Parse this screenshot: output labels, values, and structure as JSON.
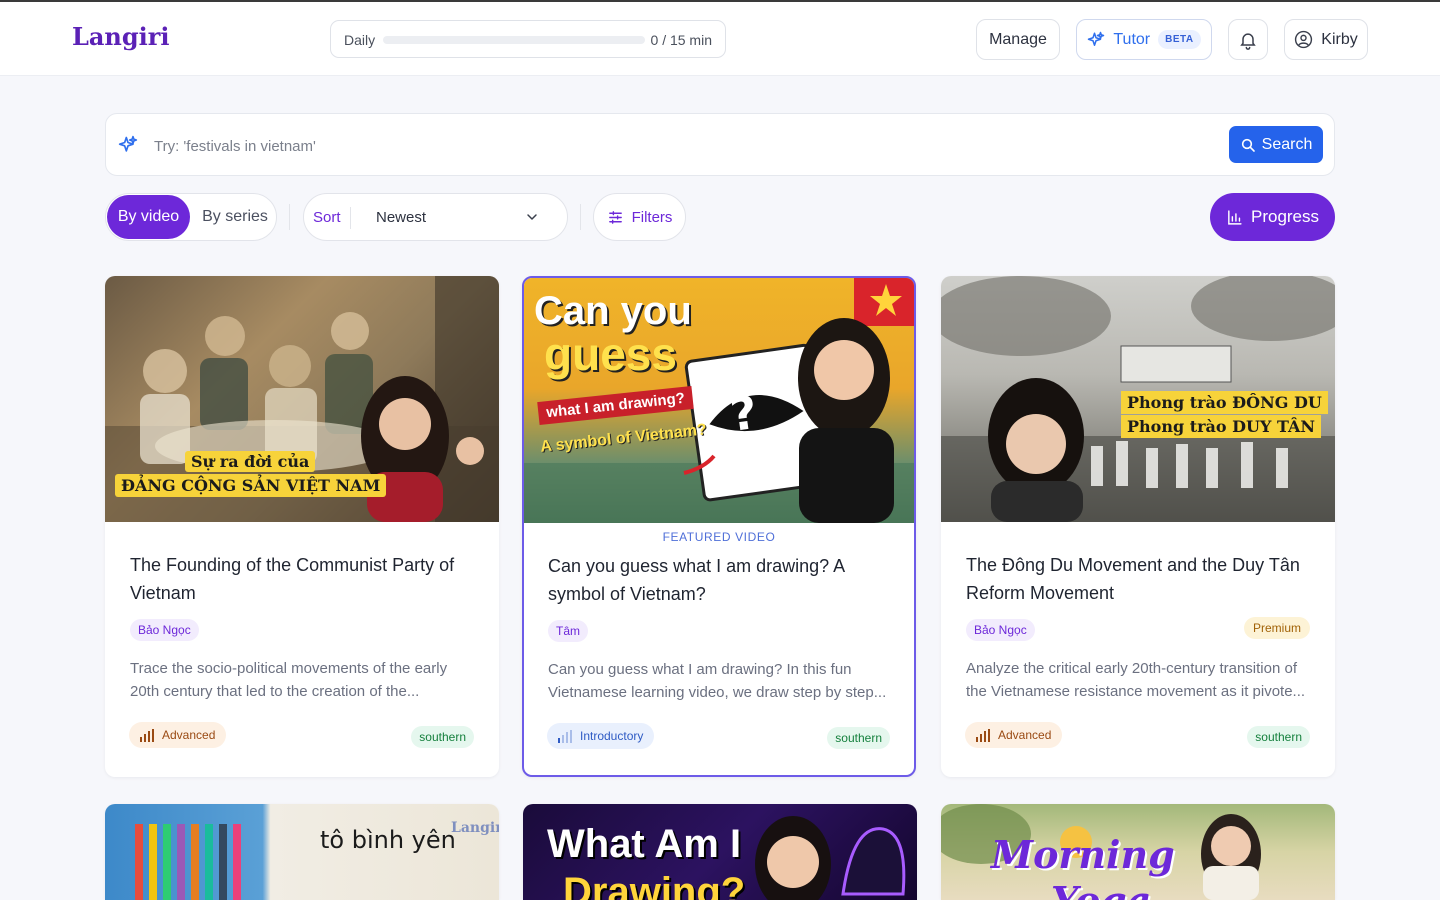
{
  "app": {
    "name": "Langiri"
  },
  "header": {
    "daily": {
      "label": "Daily",
      "progress_fraction": 0,
      "value_text": "0 / 15 min"
    },
    "manage_label": "Manage",
    "tutor_label": "Tutor",
    "tutor_badge": "BETA",
    "user_name": "Kirby"
  },
  "search": {
    "placeholder": "Try: 'festivals in vietnam'",
    "button_label": "Search"
  },
  "view_toggle": {
    "active": "By video",
    "other": "By series"
  },
  "sort": {
    "label": "Sort",
    "value": "Newest"
  },
  "filters_label": "Filters",
  "progress_label": "Progress",
  "colors": {
    "brand": "#6d28d9",
    "accent_blue": "#2563eb"
  },
  "cards": [
    {
      "thumb_text": [
        "Sự ra đời của",
        "ĐẢNG CỘNG SẢN VIỆT NAM"
      ],
      "title": "The Founding of the Communist Party of Vietnam",
      "author": "Bảo Ngọc",
      "description": "Trace the socio-political movements of the early 20th century that led to the creation of the...",
      "level": "Advanced",
      "region": "southern"
    },
    {
      "featured_label": "FEATURED VIDEO",
      "thumb_text": [
        "Can you",
        "guess",
        "what I am drawing?",
        "A symbol of Vietnam?"
      ],
      "title": "Can you guess what I am drawing? A symbol of Vietnam?",
      "author": "Tâm",
      "description": "Can you guess what I am drawing?  In this fun Vietnamese learning video, we draw step by step...",
      "level": "Introductory",
      "region": "southern"
    },
    {
      "thumb_text": [
        "Phong trào ĐÔNG DU",
        "Phong trào DUY TÂN"
      ],
      "title": "The Đông Du Movement and the Duy Tân Reform Movement",
      "author": "Bảo Ngọc",
      "badge": "Premium",
      "description": "Analyze the critical early 20th-century transition of the Vietnamese resistance movement as it pivote...",
      "level": "Advanced",
      "region": "southern"
    }
  ],
  "partial_cards": [
    {
      "thumb_text": [
        "tô bình yên",
        "Langiri"
      ]
    },
    {
      "thumb_text": [
        "What Am I",
        "Drawing?"
      ]
    },
    {
      "thumb_text": [
        "Morning",
        "Yoga"
      ]
    }
  ]
}
